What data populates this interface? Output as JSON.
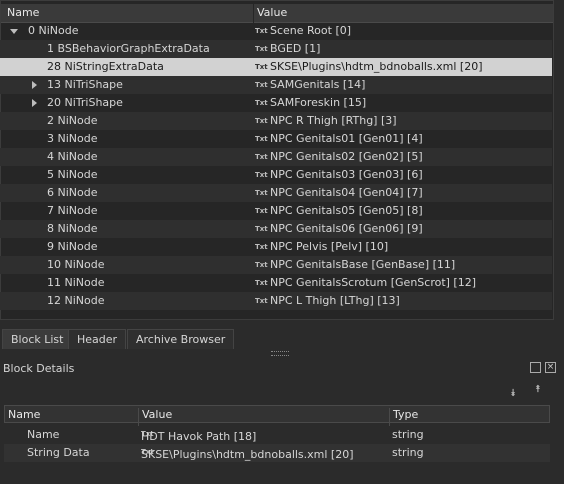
{
  "tree": {
    "col_name": "Name",
    "col_value": "Value",
    "rows": [
      {
        "name": "0 NiNode",
        "value": "Scene Root [0]"
      },
      {
        "name": "1 BSBehaviorGraphExtraData",
        "value": "BGED [1]"
      },
      {
        "name": "28 NiStringExtraData",
        "value": "SKSE\\Plugins\\hdtm_bdnoballs.xml [20]"
      },
      {
        "name": "13 NiTriShape",
        "value": "SAMGenitals [14]"
      },
      {
        "name": "20 NiTriShape",
        "value": "SAMForeskin [15]"
      },
      {
        "name": "2 NiNode",
        "value": "NPC R Thigh [RThg] [3]"
      },
      {
        "name": "3 NiNode",
        "value": "NPC Genitals01 [Gen01] [4]"
      },
      {
        "name": "4 NiNode",
        "value": "NPC Genitals02 [Gen02] [5]"
      },
      {
        "name": "5 NiNode",
        "value": "NPC Genitals03 [Gen03] [6]"
      },
      {
        "name": "6 NiNode",
        "value": "NPC Genitals04 [Gen04] [7]"
      },
      {
        "name": "7 NiNode",
        "value": "NPC Genitals05 [Gen05] [8]"
      },
      {
        "name": "8 NiNode",
        "value": "NPC Genitals06 [Gen06] [9]"
      },
      {
        "name": "9 NiNode",
        "value": "NPC Pelvis [Pelv] [10]"
      },
      {
        "name": "10 NiNode",
        "value": "NPC GenitalsBase [GenBase] [11]"
      },
      {
        "name": "11 NiNode",
        "value": "NPC GenitalsScrotum [GenScrot] [12]"
      },
      {
        "name": "12 NiNode",
        "value": "NPC L Thigh [LThg] [13]"
      }
    ]
  },
  "icon_text": "Txt",
  "tabs": [
    "Block List",
    "Header",
    "Archive Browser"
  ],
  "block_details": {
    "title": "Block Details",
    "col_name": "Name",
    "col_value": "Value",
    "col_type": "Type",
    "rows": [
      {
        "name": "Name",
        "value": "HDT Havok Path [18]",
        "type": "string"
      },
      {
        "name": "String Data",
        "value": "SKSE\\Plugins\\hdtm_bdnoballs.xml [20]",
        "type": "string"
      }
    ]
  }
}
